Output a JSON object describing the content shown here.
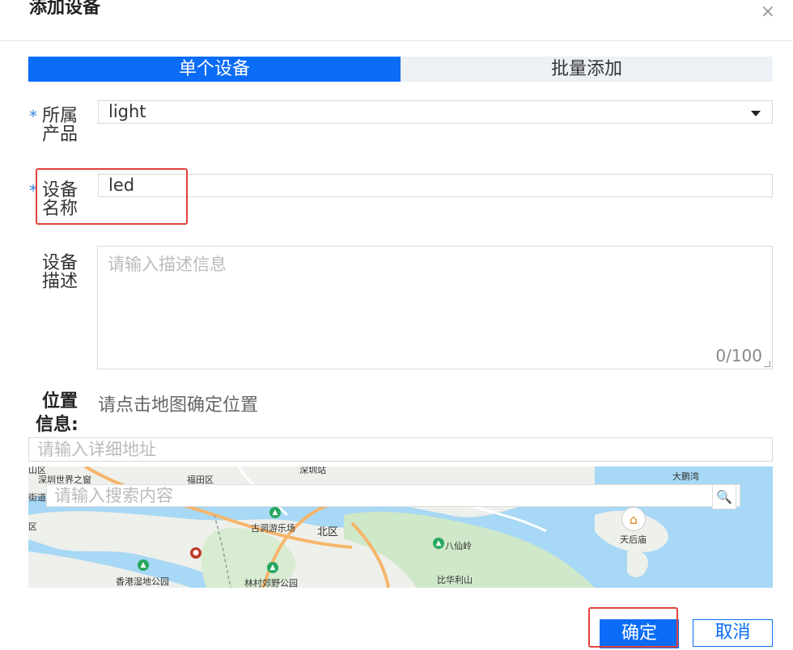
{
  "dialog": {
    "title": "添加设备",
    "close_icon": "×"
  },
  "tabs": [
    {
      "label": "单个设备",
      "active": true
    },
    {
      "label": "批量添加",
      "active": false
    }
  ],
  "form": {
    "product": {
      "label_line1": "所属",
      "label_line2": "产品",
      "value": "light",
      "required_mark": "*"
    },
    "device_name": {
      "label_line1": "设备",
      "label_line2": "名称",
      "value": "led",
      "required_mark": "*"
    },
    "description": {
      "label_line1": "设备",
      "label_line2": "描述",
      "placeholder": "请输入描述信息",
      "counter": "0/100"
    },
    "location": {
      "label_line1": "位置",
      "label_line2": "信息:",
      "hint": "请点击地图确定位置",
      "address_placeholder": "请输入详细地址"
    }
  },
  "map": {
    "search_placeholder": "请输入搜索内容",
    "search_icon": "🔍",
    "labels": {
      "l1": "山区",
      "l2": "深圳世界之窗",
      "l3": "福田区",
      "l4": "深圳站",
      "l5": "大鹏湾",
      "l6": "街道",
      "l7": "古洞游乐场",
      "l8": "北区",
      "l9": "八仙岭",
      "l10": "天后庙",
      "l11": "香港湿地公园",
      "l12": "林村郊野公园",
      "l13": "比华利山",
      "l14": "区"
    }
  },
  "buttons": {
    "confirm": "确定",
    "cancel": "取消"
  },
  "colors": {
    "accent": "#0a6cf7",
    "highlight_box": "#e0433a"
  }
}
